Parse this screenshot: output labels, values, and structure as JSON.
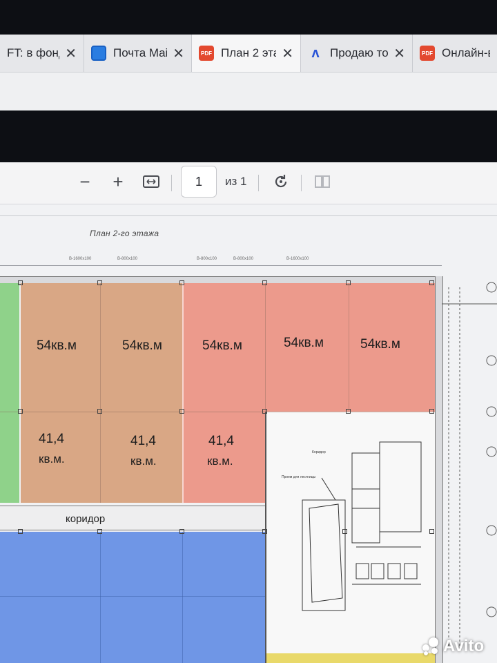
{
  "tabs": [
    {
      "title": "FT: в фонд",
      "icon": "generic-page-icon",
      "active": false
    },
    {
      "title": "Почта Mail",
      "icon": "mail-icon",
      "active": false
    },
    {
      "title": "План 2 эта",
      "icon": "pdf-icon",
      "active": true
    },
    {
      "title": "Продаю то",
      "icon": "avito-icon",
      "active": false
    },
    {
      "title": "Онлайн-вы",
      "icon": "pdf-icon",
      "active": false
    }
  ],
  "pdf_badge": "PDF",
  "toolbar": {
    "zoom_out": "−",
    "zoom_in": "+",
    "page_number": "1",
    "page_total": "из 1"
  },
  "plan": {
    "title": "План 2-го этажа",
    "dimensions": [
      "В-1600х100",
      "В-800х100",
      "В-800х100",
      "В-800х100",
      "В-1600х100"
    ],
    "rooms_top": [
      "54кв.м",
      "54кв.м",
      "54кв.м",
      "54кв.м",
      "54кв.м"
    ],
    "rooms_bottom": [
      {
        "area": "41,4",
        "unit": "кв.м."
      },
      {
        "area": "41,4",
        "unit": "кв.м."
      },
      {
        "area": "41,4",
        "unit": "кв.м."
      }
    ],
    "corridor": "коридор",
    "corridor_note": "Коридор",
    "stair_note": "Проем для лестницы",
    "colors": {
      "green": "#8fd28a",
      "brown": "#d9a785",
      "salmon": "#ec9a8c",
      "blue": "#6f96e6"
    }
  },
  "watermark": "Avito"
}
